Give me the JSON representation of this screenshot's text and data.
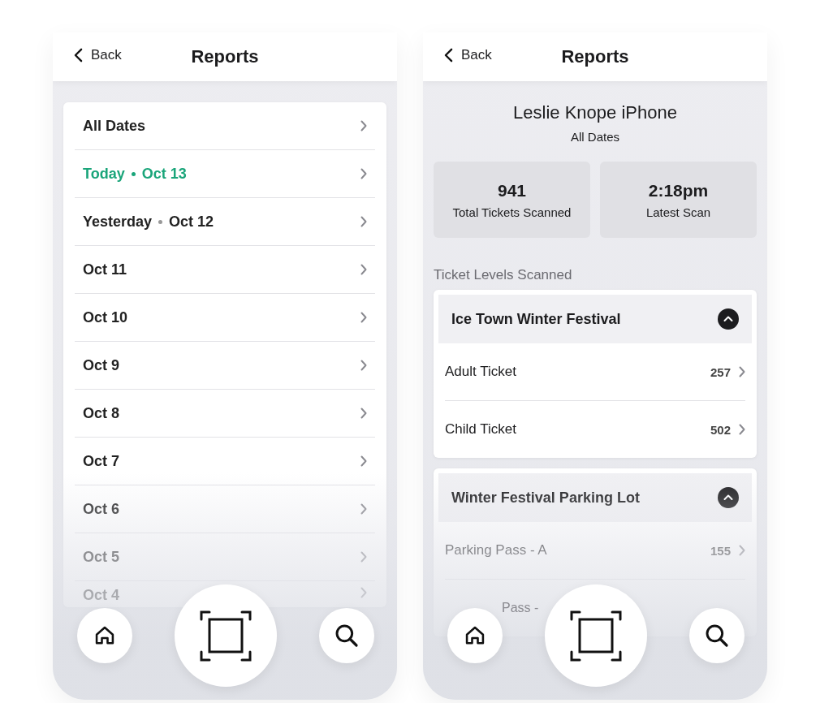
{
  "screens": [
    {
      "kind": "date_list",
      "back": "Back",
      "title": "Reports",
      "dates": [
        {
          "label": "All Dates",
          "selected": false
        },
        {
          "day": "Today",
          "label": "Oct 13",
          "selected": true
        },
        {
          "day": "Yesterday",
          "label": "Oct 12",
          "selected": false
        },
        {
          "label": "Oct 11",
          "selected": false
        },
        {
          "label": "Oct 10",
          "selected": false
        },
        {
          "label": "Oct 9",
          "selected": false
        },
        {
          "label": "Oct 8",
          "selected": false
        },
        {
          "label": "Oct 7",
          "selected": false
        },
        {
          "label": "Oct 6",
          "selected": false
        },
        {
          "label": "Oct 5",
          "selected": false
        },
        {
          "label": "Oct 4",
          "selected": false
        }
      ]
    },
    {
      "kind": "report",
      "back": "Back",
      "title": "Reports",
      "device": "Leslie Knope iPhone",
      "range": "All Dates",
      "stats": [
        {
          "value": "941",
          "label": "Total Tickets Scanned"
        },
        {
          "value": "2:18pm",
          "label": "Latest Scan"
        }
      ],
      "section": "Ticket Levels Scanned",
      "groups": [
        {
          "name": "Ice Town Winter Festival",
          "expanded": true,
          "items": [
            {
              "name": "Adult Ticket",
              "count": "257"
            },
            {
              "name": "Child Ticket",
              "count": "502"
            }
          ]
        },
        {
          "name": "Winter Festival Parking Lot",
          "expanded": true,
          "items": [
            {
              "name": "Parking Pass - A",
              "count": "155"
            },
            {
              "name": "Pass -"
            }
          ]
        }
      ]
    }
  ]
}
